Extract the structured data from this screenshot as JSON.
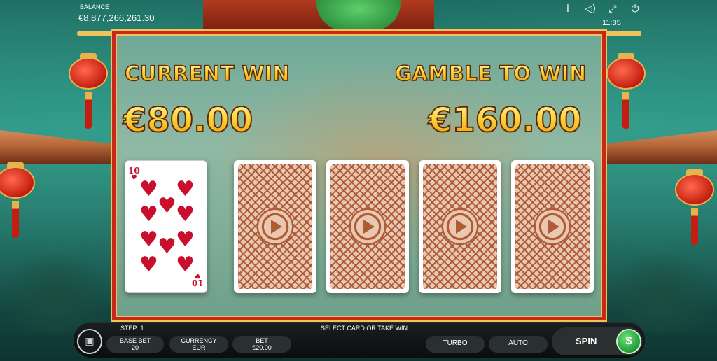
{
  "header": {
    "balance_label": "BALANCE",
    "balance_value": "€8,877,266,261.30",
    "clock": "11:35",
    "icons": [
      "info-icon",
      "sound-icon",
      "fullscreen-icon",
      "power-icon"
    ]
  },
  "gamble": {
    "current_win_label": "CURRENT WIN",
    "current_win_value": "€80.00",
    "gamble_label": "GAMBLE TO WIN",
    "gamble_value": "€160.00",
    "revealed_card": {
      "rank": "10",
      "suit": "♥",
      "color": "#c8102e"
    },
    "hidden_cards": 4
  },
  "bottom_bar": {
    "step": "STEP: 1",
    "instruction": "SELECT CARD OR TAKE WIN",
    "base_bet_label": "BASE BET",
    "base_bet_value": "20",
    "currency_label": "CURRENCY",
    "currency_value": "EUR",
    "bet_label": "BET",
    "bet_value": "€20.00",
    "turbo_label": "TURBO",
    "auto_label": "AUTO",
    "spin_label": "SPIN"
  },
  "colors": {
    "frame": "#c8281a",
    "gold": "#f0c35a",
    "heart": "#c8102e",
    "spin_green": "#2aa640"
  }
}
